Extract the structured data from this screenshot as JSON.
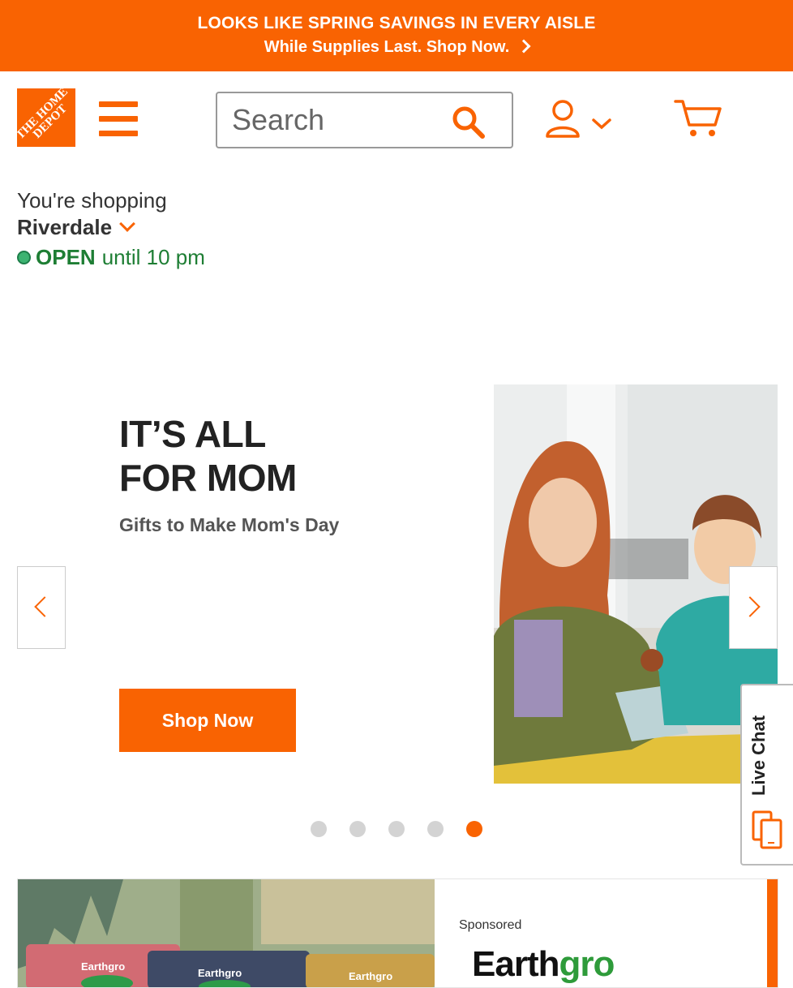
{
  "promo": {
    "headline": "LOOKS LIKE SPRING SAVINGS IN EVERY AISLE",
    "subline": "While Supplies Last. Shop Now.",
    "color": "#f96302"
  },
  "header": {
    "logo_text": "THE HOME DEPOT",
    "menu_icon": "hamburger-menu-icon",
    "search": {
      "placeholder": "Search",
      "value": ""
    },
    "search_icon": "search-icon",
    "account_icon": "user-icon",
    "cart_icon": "cart-icon"
  },
  "store": {
    "label": "You're shopping",
    "name": "Riverdale",
    "status": "OPEN",
    "hours": "until 10 pm"
  },
  "hero": {
    "title_line1": "IT’S ALL",
    "title_line2": "FOR MOM",
    "subtitle": "Gifts to Make Mom's Day",
    "cta": "Shop Now",
    "slide_count": 5,
    "active_slide": 5
  },
  "live_chat": {
    "label": "Live Chat",
    "icon": "chat-devices-icon"
  },
  "sponsored": {
    "label": "Sponsored",
    "brand_part1": "Earth",
    "brand_part2": "gro",
    "product_bag_label": "Earthgro"
  },
  "colors": {
    "brand_orange": "#f96302",
    "open_green": "#1e7e34"
  }
}
